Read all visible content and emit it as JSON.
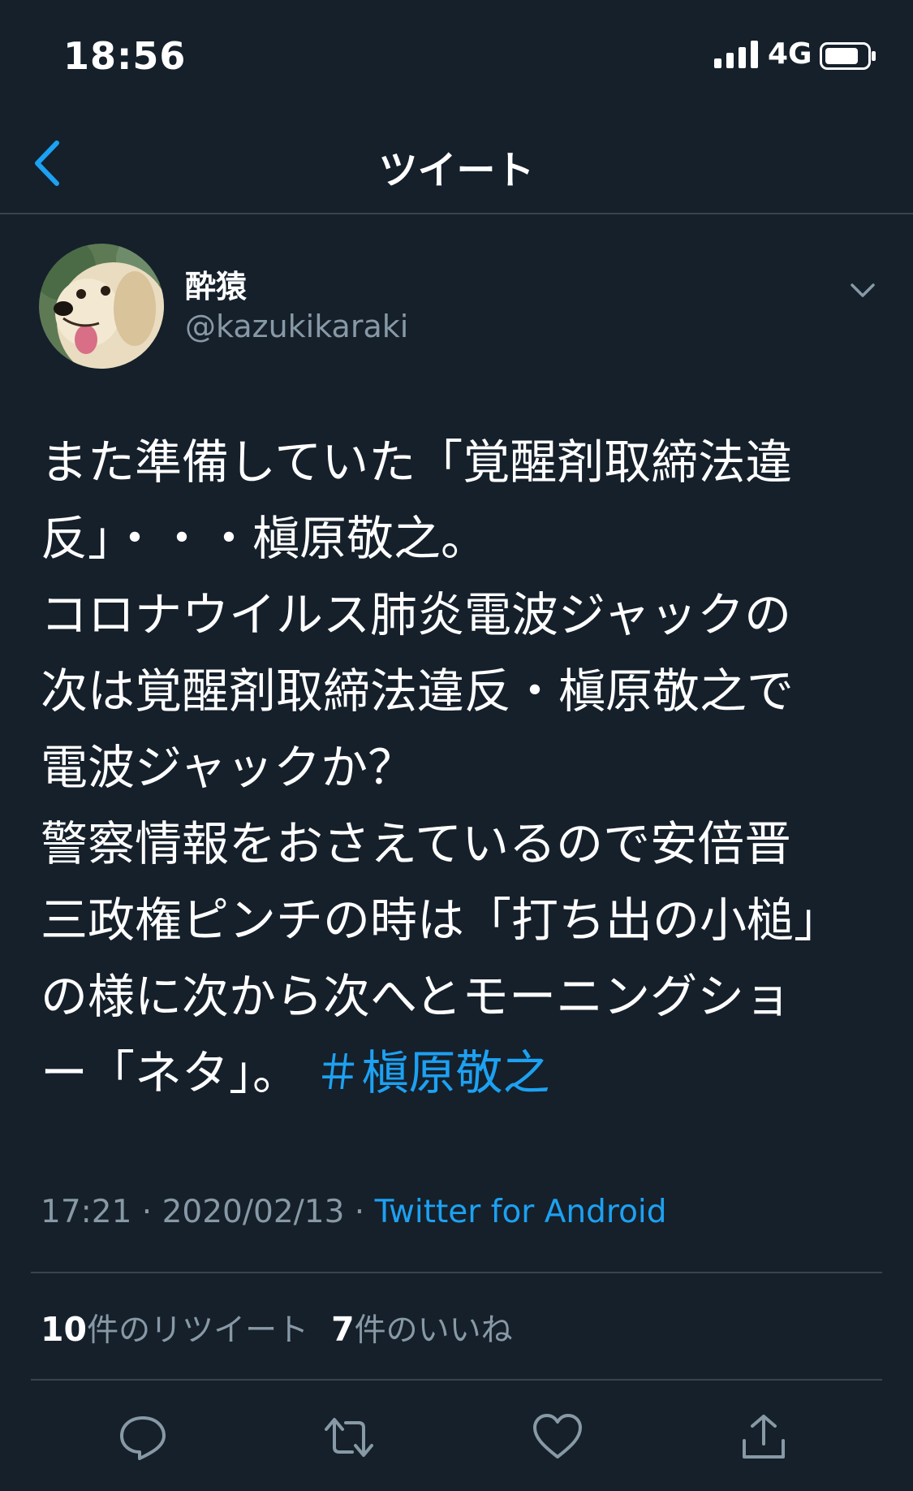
{
  "status_bar": {
    "time": "18:56",
    "network": "4G"
  },
  "header": {
    "title": "ツイート"
  },
  "author": {
    "name": "酔猿",
    "handle": "@kazukikaraki"
  },
  "tweet": {
    "lines": [
      "また準備していた「覚醒剤取締法違",
      "反」・・・槇原敬之。",
      "コロナウイルス肺炎電波ジャックの",
      "次は覚醒剤取締法違反・槇原敬之で",
      "電波ジャックか？",
      "警察情報をおさえているので安倍晋",
      "三政権ピンチの時は「打ち出の小槌」",
      "の様に次から次へとモーニングショ"
    ],
    "last_line_text": "ー「ネタ」。",
    "hashtag": "＃槇原敬之"
  },
  "meta": {
    "time": "17:21",
    "sep": " · ",
    "date": "2020/02/13",
    "source": "Twitter for Android"
  },
  "stats": {
    "retweets_count": "10",
    "retweets_label": "件のリツイート",
    "likes_count": "7",
    "likes_label": "件のいいね"
  },
  "colors": {
    "background": "#15202b",
    "accent": "#1da1f2",
    "muted": "#8899a6",
    "divider": "#38444d"
  },
  "icons": [
    "signal-icon",
    "battery-icon",
    "back-icon",
    "chevron-down-icon",
    "reply-icon",
    "retweet-icon",
    "like-icon",
    "share-icon"
  ]
}
